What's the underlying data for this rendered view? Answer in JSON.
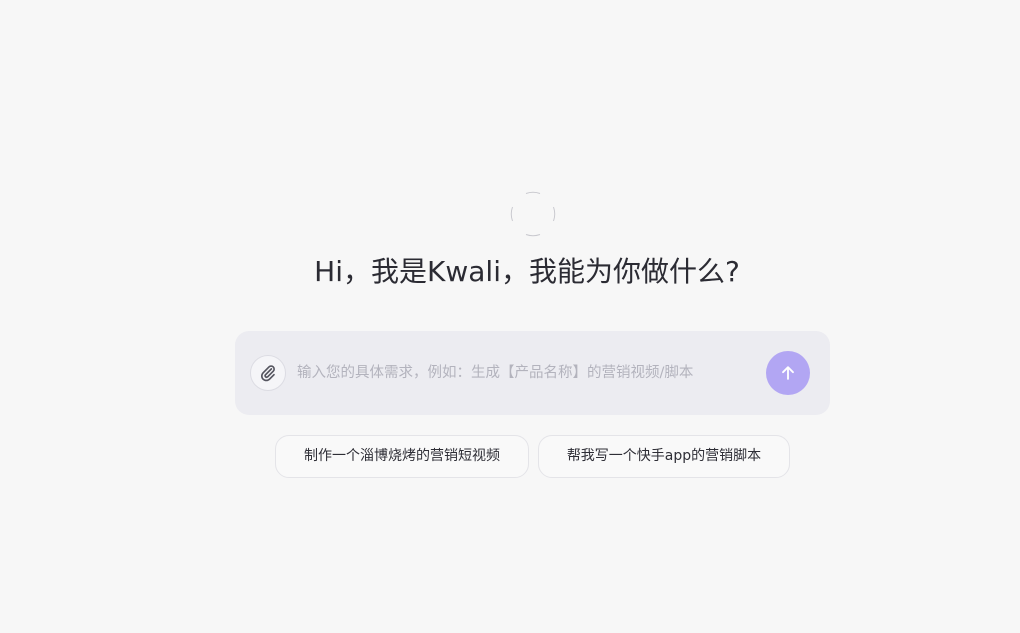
{
  "greeting": "Hi，我是Kwali，我能为你做什么?",
  "logo": {
    "icon": "loading-logo-icon"
  },
  "composer": {
    "placeholder": "输入您的具体需求，例如：生成【产品名称】的营销视频/脚本",
    "value": "",
    "attach_icon": "paperclip-icon",
    "send_icon": "arrow-up-icon",
    "send_color": "#b2a6f3"
  },
  "suggestions": [
    {
      "label": "制作一个淄博烧烤的营销短视频"
    },
    {
      "label": "帮我写一个快手app的营销脚本"
    }
  ]
}
